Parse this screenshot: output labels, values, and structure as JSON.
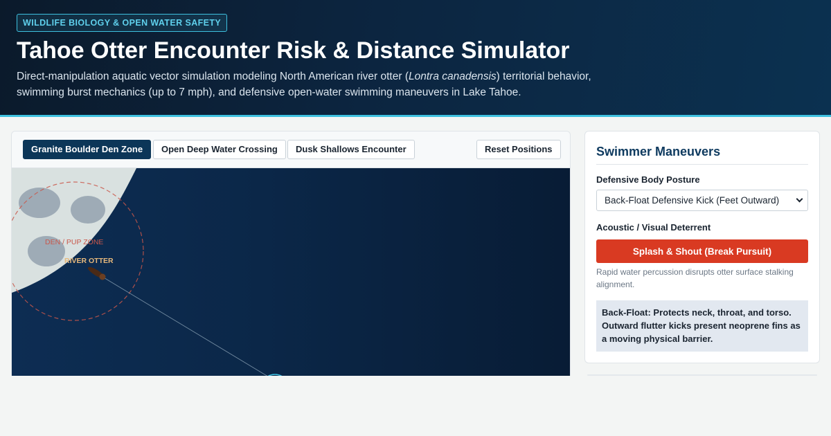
{
  "header": {
    "tag": "WILDLIFE BIOLOGY & OPEN WATER SAFETY",
    "title": "Tahoe Otter Encounter Risk & Distance Simulator",
    "desc_before": "Direct-manipulation aquatic vector simulation modeling North American river otter (",
    "desc_italic": "Lontra canadensis",
    "desc_after": ") territorial behavior, swimming burst mechanics (up to 7 mph), and defensive open-water swimming maneuvers in Lake Tahoe."
  },
  "toolbar": {
    "scenarios": [
      "Granite Boulder Den Zone",
      "Open Deep Water Crossing",
      "Dusk Shallows Encounter"
    ],
    "active_scenario": "Granite Boulder Den Zone",
    "reset_label": "Reset Positions"
  },
  "simulation": {
    "den_zone_label": "DEN / PUP ZONE",
    "otter_label": "RIVER OTTER"
  },
  "panel": {
    "title": "Swimmer Maneuvers",
    "posture_label": "Defensive Body Posture",
    "posture_value": "Back-Float Defensive Kick (Feet Outward)",
    "deterrent_label": "Acoustic / Visual Deterrent",
    "deterrent_button": "Splash & Shout (Break Pursuit)",
    "deterrent_help": "Rapid water percussion disrupts otter surface stalking alignment.",
    "info_text": "Back-Float: Protects neck, throat, and torso. Outward flutter kicks present neoprene fins as a moving physical barrier."
  },
  "colors": {
    "accent": "#3ec1e0",
    "primary": "#0c3658",
    "danger": "#d93a22",
    "water": "#0b2748",
    "shore": "#d9e1e0",
    "den_ring": "#c9574a",
    "otter_label": "#e7b97c"
  }
}
